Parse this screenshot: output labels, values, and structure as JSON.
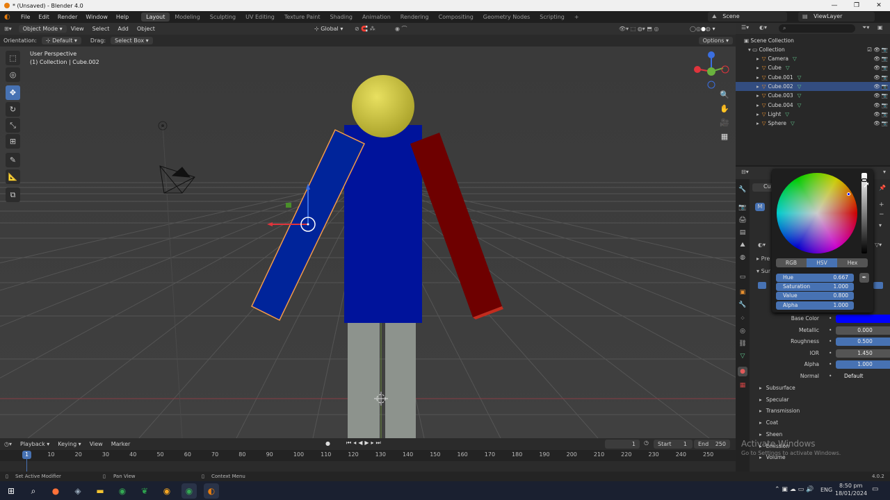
{
  "window": {
    "title": "* (Unsaved) - Blender 4.0",
    "controls": [
      "—",
      "❐",
      "✕"
    ]
  },
  "menubar": {
    "menus": [
      "File",
      "Edit",
      "Render",
      "Window",
      "Help"
    ],
    "workspaces": [
      "Layout",
      "Modeling",
      "Sculpting",
      "UV Editing",
      "Texture Paint",
      "Shading",
      "Animation",
      "Rendering",
      "Compositing",
      "Geometry Nodes",
      "Scripting"
    ],
    "active_workspace": "Layout",
    "add_tab": "+",
    "scene": "Scene",
    "view_layer": "ViewLayer"
  },
  "viewport_header": {
    "mode": "Object Mode",
    "menus": [
      "View",
      "Select",
      "Add",
      "Object"
    ],
    "transform": "Global"
  },
  "tool_header": {
    "orientation_label": "Orientation:",
    "orientation": "Default",
    "drag_label": "Drag:",
    "drag": "Select Box",
    "options": "Options"
  },
  "viewport": {
    "perspective": "User Perspective",
    "selection": "(1) Collection | Cube.002",
    "gizmo_axes": [
      "X",
      "Y",
      "Z"
    ]
  },
  "outliner": {
    "root": "Scene Collection",
    "collection": "Collection",
    "items": [
      {
        "name": "Camera",
        "selected": false
      },
      {
        "name": "Cube",
        "selected": false
      },
      {
        "name": "Cube.001",
        "selected": false
      },
      {
        "name": "Cube.002",
        "selected": true
      },
      {
        "name": "Cube.003",
        "selected": false
      },
      {
        "name": "Cube.004",
        "selected": false
      },
      {
        "name": "Light",
        "selected": false
      },
      {
        "name": "Sphere",
        "selected": false
      }
    ]
  },
  "properties": {
    "object_name": "Cu",
    "material_initial": "M",
    "section_partials": [
      "Pre",
      "Sur"
    ],
    "rows": [
      {
        "label": "Base Color",
        "value": "",
        "type": "color",
        "color": "#0000ff"
      },
      {
        "label": "Metallic",
        "value": "0.000",
        "type": "plain"
      },
      {
        "label": "Roughness",
        "value": "0.500",
        "type": "blue"
      },
      {
        "label": "IOR",
        "value": "1.450",
        "type": "plain"
      },
      {
        "label": "Alpha",
        "value": "1.000",
        "type": "blue"
      },
      {
        "label": "Normal",
        "value": "Default",
        "type": "dark"
      }
    ],
    "sections": [
      "Subsurface",
      "Specular",
      "Transmission",
      "Coat",
      "Sheen",
      "Emission",
      "Volume"
    ]
  },
  "color_picker": {
    "tabs": [
      "RGB",
      "HSV",
      "Hex"
    ],
    "active_tab": "HSV",
    "fields": [
      {
        "label": "Hue",
        "value": "0.667"
      },
      {
        "label": "Saturation",
        "value": "1.000"
      },
      {
        "label": "Value",
        "value": "0.800"
      },
      {
        "label": "Alpha",
        "value": "1.000"
      }
    ]
  },
  "timeline": {
    "menus": [
      "Playback",
      "Keying",
      "View",
      "Marker"
    ],
    "current_frame": "1",
    "start_label": "Start",
    "start": "1",
    "end_label": "End",
    "end": "250",
    "ticks": [
      "10",
      "20",
      "30",
      "40",
      "50",
      "60",
      "70",
      "80",
      "90",
      "100",
      "110",
      "120",
      "130",
      "140",
      "150",
      "160",
      "170",
      "180",
      "190",
      "200",
      "210",
      "220",
      "230",
      "240",
      "250"
    ],
    "playhead": "1"
  },
  "statusbar": {
    "left": "Set Active Modifier",
    "middle": "Pan View",
    "right": "Context Menu",
    "version": "4.0.2"
  },
  "watermark": {
    "line1": "Activate Windows",
    "line2": "Go to Settings to activate Windows."
  },
  "taskbar": {
    "lang": "ENG",
    "time": "8:50 pm",
    "date": "18/01/2024"
  }
}
